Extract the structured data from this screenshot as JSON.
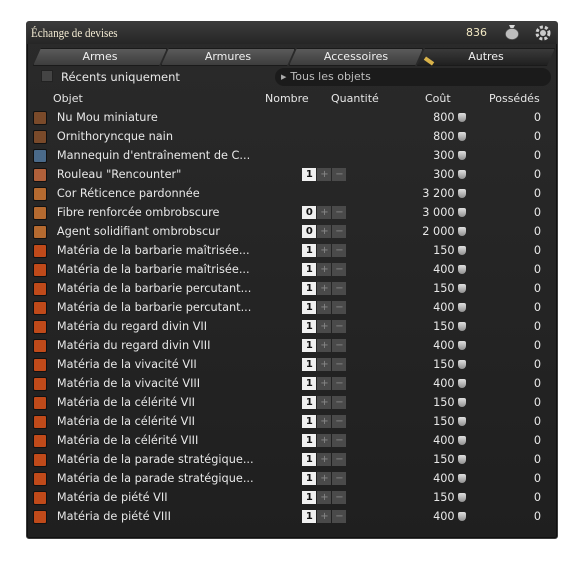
{
  "window": {
    "title": "Échange de devises",
    "currency_amount": "836"
  },
  "tabs": [
    "Armes",
    "Armures",
    "Accessoires",
    "Autres"
  ],
  "active_tab": "Autres",
  "filters": {
    "recent_label": "Récents uniquement",
    "category_select": "Tous les objets"
  },
  "columns": {
    "item": "Objet",
    "count": "Nombre",
    "quantity": "Quantité",
    "cost": "Coût",
    "owned": "Possédés"
  },
  "items": [
    {
      "name": "Nu Mou miniature",
      "qty": "",
      "cost": "800",
      "owned": "0",
      "icon_color": "#7a4a2a"
    },
    {
      "name": "Ornithoryncque nain",
      "qty": "",
      "cost": "800",
      "owned": "0",
      "icon_color": "#7a4a2a"
    },
    {
      "name": "Mannequin d'entraînement de C...",
      "qty": "",
      "cost": "300",
      "owned": "0",
      "icon_color": "#4a6a8a"
    },
    {
      "name": "Rouleau \"Rencounter\"",
      "qty": "1",
      "cost": "300",
      "owned": "0",
      "icon_color": "#b0603a"
    },
    {
      "name": "Cor Réticence pardonnée",
      "qty": "",
      "cost": "3 200",
      "owned": "0",
      "icon_color": "#b56a30"
    },
    {
      "name": "Fibre renforcée ombrobscure",
      "qty": "0",
      "cost": "3 000",
      "owned": "0",
      "icon_color": "#b56a30"
    },
    {
      "name": "Agent solidifiant ombrobscur",
      "qty": "0",
      "cost": "2 000",
      "owned": "0",
      "icon_color": "#b56a30"
    },
    {
      "name": "Matéria de la barbarie maîtrisée...",
      "qty": "1",
      "cost": "150",
      "owned": "0",
      "icon_color": "#c04a1a"
    },
    {
      "name": "Matéria de la barbarie maîtrisée...",
      "qty": "1",
      "cost": "400",
      "owned": "0",
      "icon_color": "#c04a1a"
    },
    {
      "name": "Matéria de la barbarie percutant...",
      "qty": "1",
      "cost": "150",
      "owned": "0",
      "icon_color": "#c04a1a"
    },
    {
      "name": "Matéria de la barbarie percutant...",
      "qty": "1",
      "cost": "400",
      "owned": "0",
      "icon_color": "#c04a1a"
    },
    {
      "name": "Matéria du regard divin VII",
      "qty": "1",
      "cost": "150",
      "owned": "0",
      "icon_color": "#c04a1a"
    },
    {
      "name": "Matéria du regard divin VIII",
      "qty": "1",
      "cost": "400",
      "owned": "0",
      "icon_color": "#c04a1a"
    },
    {
      "name": "Matéria de la vivacité VII",
      "qty": "1",
      "cost": "150",
      "owned": "0",
      "icon_color": "#c04a1a"
    },
    {
      "name": "Matéria de la vivacité VIII",
      "qty": "1",
      "cost": "400",
      "owned": "0",
      "icon_color": "#c04a1a"
    },
    {
      "name": "Matéria de la célérité VII",
      "qty": "1",
      "cost": "150",
      "owned": "0",
      "icon_color": "#c04a1a"
    },
    {
      "name": "Matéria de la célérité VII",
      "qty": "1",
      "cost": "150",
      "owned": "0",
      "icon_color": "#c04a1a"
    },
    {
      "name": "Matéria de la célérité VIII",
      "qty": "1",
      "cost": "400",
      "owned": "0",
      "icon_color": "#c04a1a"
    },
    {
      "name": "Matéria de la parade stratégique...",
      "qty": "1",
      "cost": "150",
      "owned": "0",
      "icon_color": "#c04a1a"
    },
    {
      "name": "Matéria de la parade stratégique...",
      "qty": "1",
      "cost": "400",
      "owned": "0",
      "icon_color": "#c04a1a"
    },
    {
      "name": "Matéria de piété VII",
      "qty": "1",
      "cost": "150",
      "owned": "0",
      "icon_color": "#c04a1a"
    },
    {
      "name": "Matéria de piété VIII",
      "qty": "1",
      "cost": "400",
      "owned": "0",
      "icon_color": "#c04a1a"
    }
  ],
  "stepper": {
    "plus": "+",
    "minus": "−"
  },
  "icons": {
    "currency": "money-bag-icon",
    "settings": "gear-icon",
    "list_item": "materia-icon"
  }
}
